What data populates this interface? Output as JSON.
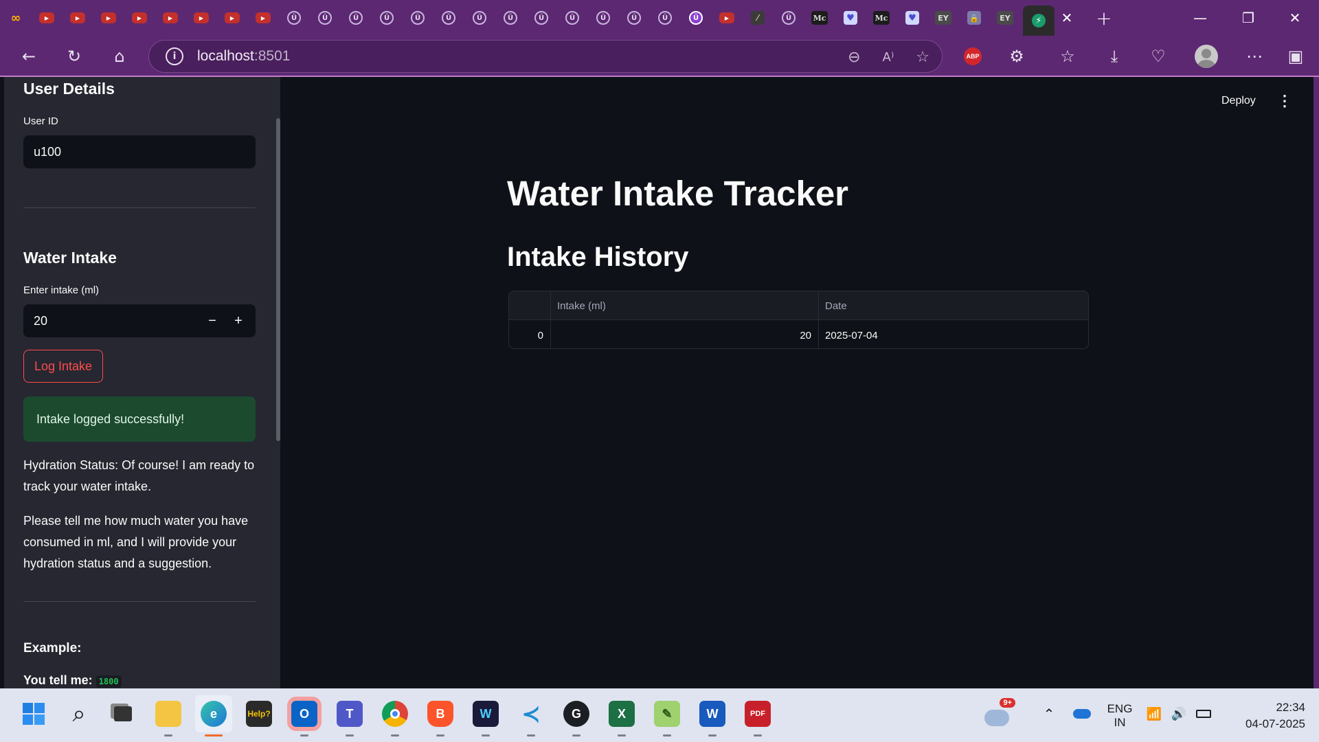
{
  "browser": {
    "url_host": "localhost",
    "url_port": ":8501",
    "tab_favicons": [
      "logo",
      "yt",
      "yt",
      "yt",
      "yt",
      "yt",
      "yt",
      "yt",
      "yt",
      "ring",
      "ring",
      "ring",
      "ring",
      "ring",
      "ring",
      "ring",
      "ring",
      "ring",
      "ring",
      "ring",
      "ring",
      "ring",
      "ringfill",
      "yt",
      "line",
      "ring",
      "mc",
      "heart",
      "mc",
      "heart",
      "ey",
      "lock",
      "ey",
      "streamlit"
    ],
    "tab_labels": {
      "logo": "∞",
      "yt": "▶",
      "ring": "Ü",
      "ringfill": "Ü",
      "line": "⁄",
      "mc": "Mc",
      "heart": "♥",
      "ey": "EY",
      "lock": "🔒",
      "streamlit": "⚡"
    },
    "abp_label": "ABP"
  },
  "app": {
    "header": {
      "deploy_label": "Deploy"
    },
    "title": "Water Intake Tracker",
    "history_heading": "Intake History",
    "table": {
      "columns": [
        "",
        "Intake (ml)",
        "Date"
      ],
      "rows": [
        {
          "index": "0",
          "intake": "20",
          "date": "2025-07-04"
        }
      ]
    }
  },
  "sidebar": {
    "user_details_heading": "User Details",
    "user_id_label": "User ID",
    "user_id_value": "u100",
    "water_intake_heading": "Water Intake",
    "intake_label": "Enter intake (ml)",
    "intake_value": "20",
    "log_button_label": "Log Intake",
    "success_message": "Intake logged successfully!",
    "status_paragraph": "Hydration Status: Of course! I am ready to track your water intake.",
    "prompt_paragraph": "Please tell me how much water you have consumed in ml, and I will provide your hydration status and a suggestion.",
    "example_heading": "Example:",
    "example_you_tell": "You tell me:",
    "example_code": "1800"
  },
  "taskbar": {
    "language_line1": "ENG",
    "language_line2": "IN",
    "time": "22:34",
    "date": "04-07-2025",
    "weather_badge": "9+"
  },
  "colors": {
    "browser_frame": "#5c2872",
    "app_background": "#0e1117",
    "sidebar_background": "#262730",
    "accent_red": "#ff4b4b",
    "success_background": "#1c4a2f"
  }
}
